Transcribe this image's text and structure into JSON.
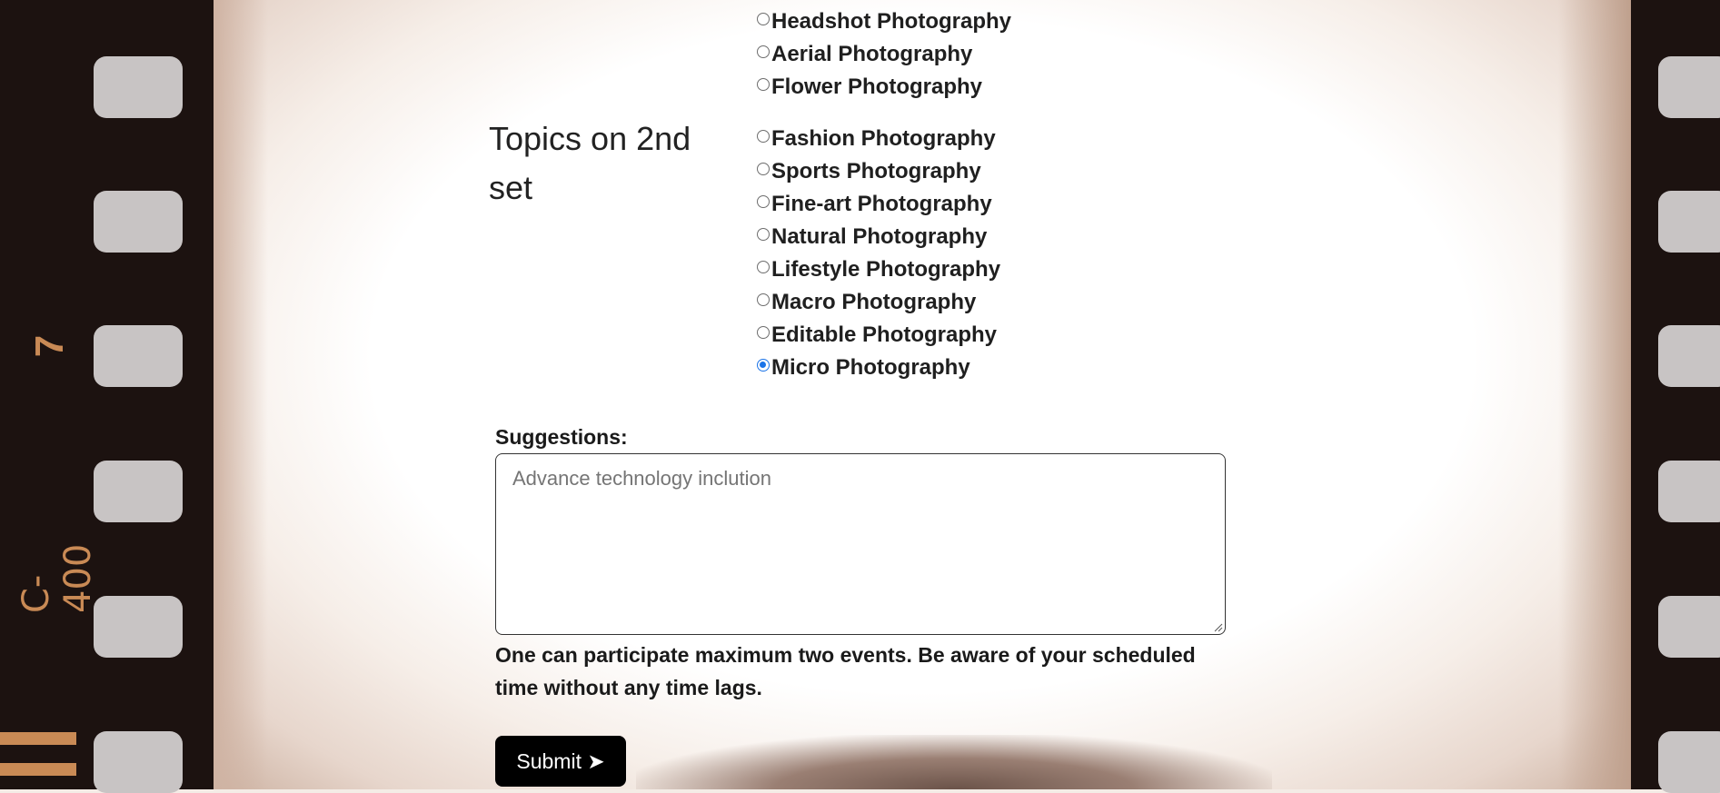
{
  "film_strip": {
    "code": "C-400",
    "frame_number": "7"
  },
  "form": {
    "topics_label": "Topics on 2nd set",
    "prev_group_options": [
      {
        "label": "Headshot Photography",
        "checked": false
      },
      {
        "label": "Aerial Photography",
        "checked": false
      },
      {
        "label": "Flower Photography",
        "checked": false
      }
    ],
    "topics": [
      {
        "label": "Fashion Photography",
        "checked": false
      },
      {
        "label": "Sports Photography",
        "checked": false
      },
      {
        "label": "Fine-art Photography",
        "checked": false
      },
      {
        "label": "Natural Photography",
        "checked": false
      },
      {
        "label": "Lifestyle Photography",
        "checked": false
      },
      {
        "label": "Macro Photography",
        "checked": false
      },
      {
        "label": "Editable Photography",
        "checked": false
      },
      {
        "label": "Micro Photography",
        "checked": true
      }
    ],
    "suggestions_label": "Suggestions:",
    "suggestions_placeholder": "Advance technology inclution",
    "note": "One can participate maximum two events. Be aware of your scheduled time without any time lags.",
    "submit_label": "Submit ➤"
  },
  "colors": {
    "accent": "#1a73e8",
    "button": "#000000",
    "film": "#1c1210",
    "film_text": "#c98a55"
  }
}
